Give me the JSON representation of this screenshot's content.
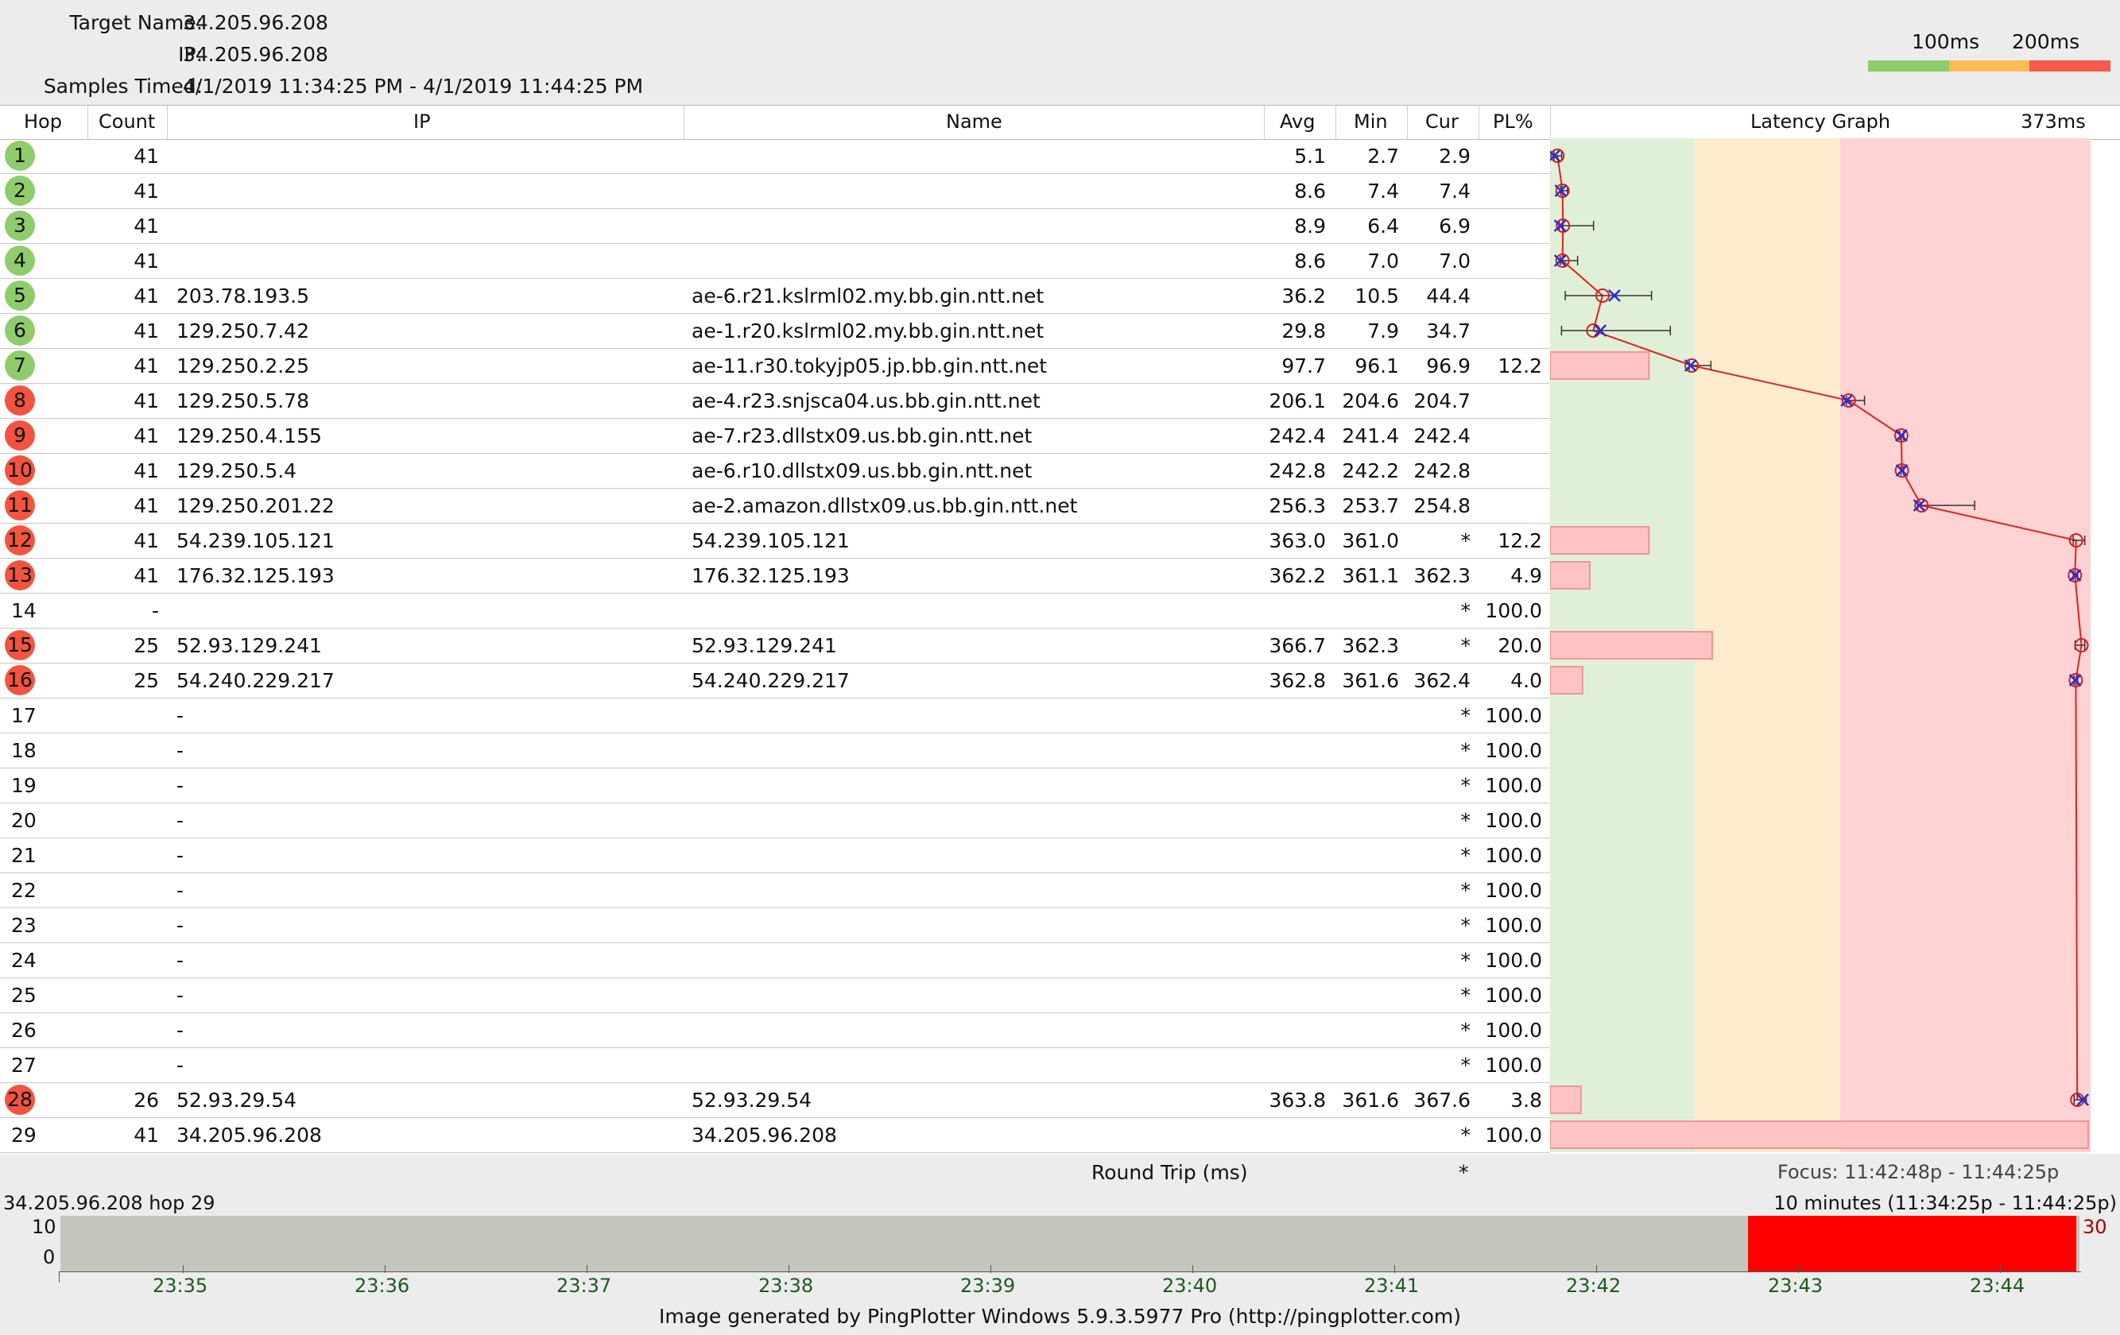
{
  "header": {
    "target_label": "Target Name:",
    "target_value": "34.205.96.208",
    "ip_label": "IP:",
    "ip_value": "34.205.96.208",
    "samples_label": "Samples Timed:",
    "samples_value": "4/1/2019 11:34:25 PM - 4/1/2019 11:44:25 PM",
    "scale_100": "100ms",
    "scale_200": "200ms",
    "colors": {
      "good": "#8fcc6c",
      "warn": "#fdbb54",
      "bad": "#f55a4a"
    }
  },
  "columns": {
    "hop": "Hop",
    "count": "Count",
    "ip": "IP",
    "name": "Name",
    "avg": "Avg",
    "min": "Min",
    "cur": "Cur",
    "pl": "PL%",
    "graph": "Latency Graph",
    "graph_max": "373ms"
  },
  "graph_max_ms": 373,
  "rows": [
    {
      "hop": "1",
      "status": "green",
      "count": "41",
      "ip": "",
      "name": "",
      "avg": "5.1",
      "min": "2.7",
      "cur": "2.9",
      "pl": "",
      "avg_ms": 5.1,
      "min_ms": 2.7,
      "cur_ms": 2.9,
      "max_ms": 8,
      "pl_pct": 0
    },
    {
      "hop": "2",
      "status": "green",
      "count": "41",
      "ip": "",
      "name": "",
      "avg": "8.6",
      "min": "7.4",
      "cur": "7.4",
      "pl": "",
      "avg_ms": 8.6,
      "min_ms": 7.4,
      "cur_ms": 7.4,
      "max_ms": 12,
      "pl_pct": 0
    },
    {
      "hop": "3",
      "status": "green",
      "count": "41",
      "ip": "",
      "name": "",
      "avg": "8.9",
      "min": "6.4",
      "cur": "6.9",
      "pl": "",
      "avg_ms": 8.9,
      "min_ms": 6.4,
      "cur_ms": 6.9,
      "max_ms": 30,
      "pl_pct": 0
    },
    {
      "hop": "4",
      "status": "green",
      "count": "41",
      "ip": "",
      "name": "",
      "avg": "8.6",
      "min": "7.0",
      "cur": "7.0",
      "pl": "",
      "avg_ms": 8.6,
      "min_ms": 7.0,
      "cur_ms": 7.0,
      "max_ms": 19,
      "pl_pct": 0
    },
    {
      "hop": "5",
      "status": "green",
      "count": "41",
      "ip": "203.78.193.5",
      "name": "ae-6.r21.kslrml02.my.bb.gin.ntt.net",
      "avg": "36.2",
      "min": "10.5",
      "cur": "44.4",
      "pl": "",
      "avg_ms": 36.2,
      "min_ms": 10.5,
      "cur_ms": 44.4,
      "max_ms": 70,
      "pl_pct": 0
    },
    {
      "hop": "6",
      "status": "green",
      "count": "41",
      "ip": "129.250.7.42",
      "name": "ae-1.r20.kslrml02.my.bb.gin.ntt.net",
      "avg": "29.8",
      "min": "7.9",
      "cur": "34.7",
      "pl": "",
      "avg_ms": 29.8,
      "min_ms": 7.9,
      "cur_ms": 34.7,
      "max_ms": 83,
      "pl_pct": 0
    },
    {
      "hop": "7",
      "status": "green",
      "count": "41",
      "ip": "129.250.2.25",
      "name": "ae-11.r30.tokyjp05.jp.bb.gin.ntt.net",
      "avg": "97.7",
      "min": "96.1",
      "cur": "96.9",
      "pl": "12.2",
      "avg_ms": 97.7,
      "min_ms": 96.1,
      "cur_ms": 96.9,
      "max_ms": 111,
      "pl_pct": 12.2
    },
    {
      "hop": "8",
      "status": "red",
      "count": "41",
      "ip": "129.250.5.78",
      "name": "ae-4.r23.snjsca04.us.bb.gin.ntt.net",
      "avg": "206.1",
      "min": "204.6",
      "cur": "204.7",
      "pl": "",
      "avg_ms": 206.1,
      "min_ms": 204.6,
      "cur_ms": 204.7,
      "max_ms": 217,
      "pl_pct": 0
    },
    {
      "hop": "9",
      "status": "red",
      "count": "41",
      "ip": "129.250.4.155",
      "name": "ae-7.r23.dllstx09.us.bb.gin.ntt.net",
      "avg": "242.4",
      "min": "241.4",
      "cur": "242.4",
      "pl": "",
      "avg_ms": 242.4,
      "min_ms": 241.4,
      "cur_ms": 242.4,
      "max_ms": 244,
      "pl_pct": 0
    },
    {
      "hop": "10",
      "status": "red",
      "count": "41",
      "ip": "129.250.5.4",
      "name": "ae-6.r10.dllstx09.us.bb.gin.ntt.net",
      "avg": "242.8",
      "min": "242.2",
      "cur": "242.8",
      "pl": "",
      "avg_ms": 242.8,
      "min_ms": 242.2,
      "cur_ms": 242.8,
      "max_ms": 244,
      "pl_pct": 0
    },
    {
      "hop": "11",
      "status": "red",
      "count": "41",
      "ip": "129.250.201.22",
      "name": "ae-2.amazon.dllstx09.us.bb.gin.ntt.net",
      "avg": "256.3",
      "min": "253.7",
      "cur": "254.8",
      "pl": "",
      "avg_ms": 256.3,
      "min_ms": 253.7,
      "cur_ms": 254.8,
      "max_ms": 293,
      "pl_pct": 0
    },
    {
      "hop": "12",
      "status": "red",
      "count": "41",
      "ip": "54.239.105.121",
      "name": "54.239.105.121",
      "avg": "363.0",
      "min": "361.0",
      "cur": "*",
      "pl": "12.2",
      "avg_ms": 363.0,
      "min_ms": 361.0,
      "cur_ms": null,
      "max_ms": 369,
      "pl_pct": 12.2
    },
    {
      "hop": "13",
      "status": "red",
      "count": "41",
      "ip": "176.32.125.193",
      "name": "176.32.125.193",
      "avg": "362.2",
      "min": "361.1",
      "cur": "362.3",
      "pl": "4.9",
      "avg_ms": 362.2,
      "min_ms": 361.1,
      "cur_ms": 362.3,
      "max_ms": 364,
      "pl_pct": 4.9
    },
    {
      "hop": "14",
      "status": "none",
      "count": "-",
      "ip": "",
      "name": "",
      "avg": "",
      "min": "",
      "cur": "*",
      "pl": "100.0",
      "avg_ms": null,
      "min_ms": null,
      "cur_ms": null,
      "max_ms": null,
      "pl_pct": 0
    },
    {
      "hop": "15",
      "status": "red",
      "count": "25",
      "ip": "52.93.129.241",
      "name": "52.93.129.241",
      "avg": "366.7",
      "min": "362.3",
      "cur": "*",
      "pl": "20.0",
      "avg_ms": 366.7,
      "min_ms": 362.3,
      "cur_ms": null,
      "max_ms": 369,
      "pl_pct": 20.0
    },
    {
      "hop": "16",
      "status": "red",
      "count": "25",
      "ip": "54.240.229.217",
      "name": "54.240.229.217",
      "avg": "362.8",
      "min": "361.6",
      "cur": "362.4",
      "pl": "4.0",
      "avg_ms": 362.8,
      "min_ms": 361.6,
      "cur_ms": 362.4,
      "max_ms": 364,
      "pl_pct": 4.0
    },
    {
      "hop": "17",
      "status": "none",
      "count": "",
      "ip": "-",
      "name": "",
      "avg": "",
      "min": "",
      "cur": "*",
      "pl": "100.0",
      "avg_ms": null,
      "min_ms": null,
      "cur_ms": null,
      "max_ms": null,
      "pl_pct": 0
    },
    {
      "hop": "18",
      "status": "none",
      "count": "",
      "ip": "-",
      "name": "",
      "avg": "",
      "min": "",
      "cur": "*",
      "pl": "100.0",
      "avg_ms": null,
      "min_ms": null,
      "cur_ms": null,
      "max_ms": null,
      "pl_pct": 0
    },
    {
      "hop": "19",
      "status": "none",
      "count": "",
      "ip": "-",
      "name": "",
      "avg": "",
      "min": "",
      "cur": "*",
      "pl": "100.0",
      "avg_ms": null,
      "min_ms": null,
      "cur_ms": null,
      "max_ms": null,
      "pl_pct": 0
    },
    {
      "hop": "20",
      "status": "none",
      "count": "",
      "ip": "-",
      "name": "",
      "avg": "",
      "min": "",
      "cur": "*",
      "pl": "100.0",
      "avg_ms": null,
      "min_ms": null,
      "cur_ms": null,
      "max_ms": null,
      "pl_pct": 0
    },
    {
      "hop": "21",
      "status": "none",
      "count": "",
      "ip": "-",
      "name": "",
      "avg": "",
      "min": "",
      "cur": "*",
      "pl": "100.0",
      "avg_ms": null,
      "min_ms": null,
      "cur_ms": null,
      "max_ms": null,
      "pl_pct": 0
    },
    {
      "hop": "22",
      "status": "none",
      "count": "",
      "ip": "-",
      "name": "",
      "avg": "",
      "min": "",
      "cur": "*",
      "pl": "100.0",
      "avg_ms": null,
      "min_ms": null,
      "cur_ms": null,
      "max_ms": null,
      "pl_pct": 0
    },
    {
      "hop": "23",
      "status": "none",
      "count": "",
      "ip": "-",
      "name": "",
      "avg": "",
      "min": "",
      "cur": "*",
      "pl": "100.0",
      "avg_ms": null,
      "min_ms": null,
      "cur_ms": null,
      "max_ms": null,
      "pl_pct": 0
    },
    {
      "hop": "24",
      "status": "none",
      "count": "",
      "ip": "-",
      "name": "",
      "avg": "",
      "min": "",
      "cur": "*",
      "pl": "100.0",
      "avg_ms": null,
      "min_ms": null,
      "cur_ms": null,
      "max_ms": null,
      "pl_pct": 0
    },
    {
      "hop": "25",
      "status": "none",
      "count": "",
      "ip": "-",
      "name": "",
      "avg": "",
      "min": "",
      "cur": "*",
      "pl": "100.0",
      "avg_ms": null,
      "min_ms": null,
      "cur_ms": null,
      "max_ms": null,
      "pl_pct": 0
    },
    {
      "hop": "26",
      "status": "none",
      "count": "",
      "ip": "-",
      "name": "",
      "avg": "",
      "min": "",
      "cur": "*",
      "pl": "100.0",
      "avg_ms": null,
      "min_ms": null,
      "cur_ms": null,
      "max_ms": null,
      "pl_pct": 0
    },
    {
      "hop": "27",
      "status": "none",
      "count": "",
      "ip": "-",
      "name": "",
      "avg": "",
      "min": "",
      "cur": "*",
      "pl": "100.0",
      "avg_ms": null,
      "min_ms": null,
      "cur_ms": null,
      "max_ms": null,
      "pl_pct": 0
    },
    {
      "hop": "28",
      "status": "red",
      "count": "26",
      "ip": "52.93.29.54",
      "name": "52.93.29.54",
      "avg": "363.8",
      "min": "361.6",
      "cur": "367.6",
      "pl": "3.8",
      "avg_ms": 363.8,
      "min_ms": 361.6,
      "cur_ms": 367.6,
      "max_ms": 370,
      "pl_pct": 3.8
    },
    {
      "hop": "29",
      "status": "none",
      "count": "41",
      "ip": "34.205.96.208",
      "name": "34.205.96.208",
      "avg": "",
      "min": "",
      "cur": "*",
      "pl": "100.0",
      "avg_ms": null,
      "min_ms": null,
      "cur_ms": null,
      "max_ms": null,
      "pl_pct": 100
    }
  ],
  "footer": {
    "round_trip": "Round Trip (ms)",
    "round_trip_cur": "*",
    "focus": "Focus: 11:42:48p - 11:44:25p"
  },
  "timeline": {
    "title": "34.205.96.208 hop 29",
    "range": "10 minutes (11:34:25p - 11:44:25p)",
    "y_top": "10",
    "y_bottom": "0",
    "right_value": "30",
    "ticks": [
      "23:35",
      "23:36",
      "23:37",
      "23:38",
      "23:39",
      "23:40",
      "23:41",
      "23:42",
      "23:43",
      "23:44"
    ],
    "loss_start_fraction": 0.836
  },
  "credit": "Image generated by PingPlotter Windows 5.9.3.5977 Pro (http://pingplotter.com)"
}
